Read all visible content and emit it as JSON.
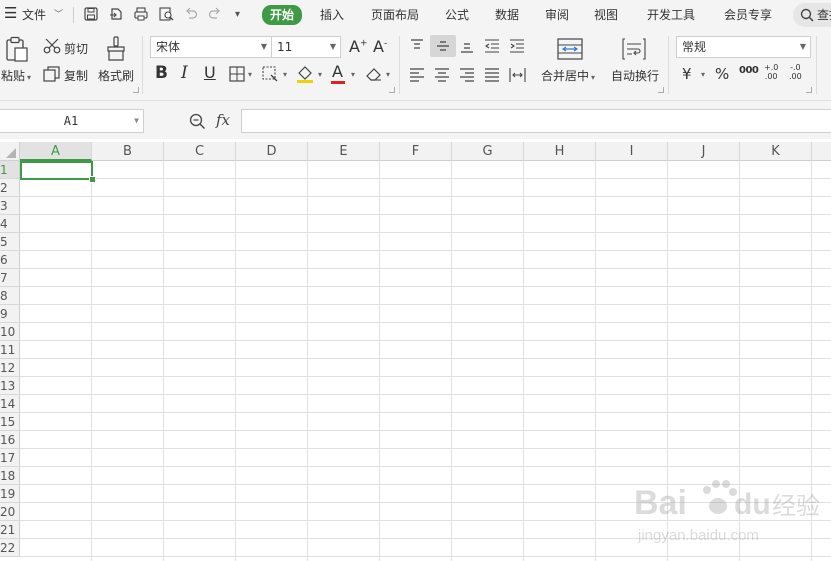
{
  "menu": {
    "file_label": "文件",
    "tabs": [
      "开始",
      "插入",
      "页面布局",
      "公式",
      "数据",
      "审阅",
      "视图",
      "开发工具",
      "会员专享"
    ],
    "active_tab": "开始",
    "search_label": "查找"
  },
  "ribbon": {
    "paste_label": "粘贴",
    "cut_label": "剪切",
    "copy_label": "复制",
    "format_painter_label": "格式刷",
    "font_name": "宋体",
    "font_size": "11",
    "merge_center_label": "合并居中",
    "wrap_text_label": "自动换行",
    "number_format": "常规",
    "bold_glyph": "B",
    "italic_glyph": "I",
    "underline_glyph": "U",
    "currency_glyph": "¥",
    "percent_glyph": "%",
    "thousands_glyph": "000",
    "inc_decimal_glyph": "+.0\n.00",
    "dec_decimal_glyph": "-.0\n.00"
  },
  "formula_bar": {
    "name_box": "A1",
    "fx_label": "fx",
    "value": ""
  },
  "sheet": {
    "columns": [
      "A",
      "B",
      "C",
      "D",
      "E",
      "F",
      "G",
      "H",
      "I",
      "J",
      "K"
    ],
    "rows": [
      "1",
      "2",
      "3",
      "4",
      "5",
      "6",
      "7",
      "8",
      "9",
      "10",
      "11",
      "12",
      "13",
      "14",
      "15",
      "16",
      "17",
      "18",
      "19",
      "20",
      "21",
      "22"
    ],
    "selected_cell": "A1"
  },
  "watermark": {
    "brand": "Bai du 经验",
    "url": "jingyan.baidu.com"
  },
  "colors": {
    "accent": "#3e9a45",
    "toolbar_bg": "#f4f4f4",
    "grid_line": "#e0e0e0"
  }
}
